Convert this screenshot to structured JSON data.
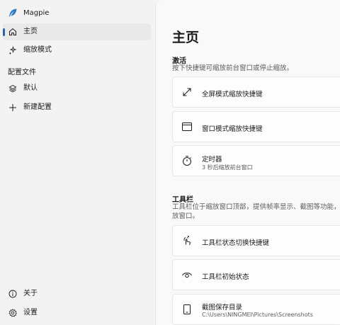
{
  "app": {
    "title": "Magpie"
  },
  "sidebar": {
    "items": [
      {
        "label": "主页",
        "icon": "home-icon",
        "selected": true
      },
      {
        "label": "缩放模式",
        "icon": "sparkle-icon",
        "selected": false
      }
    ],
    "profiles_section": "配置文件",
    "profiles": [
      {
        "label": "默认",
        "icon": "layers-icon"
      },
      {
        "label": "新建配置",
        "icon": "add-icon"
      }
    ],
    "footer": [
      {
        "label": "关于",
        "icon": "info-icon"
      },
      {
        "label": "设置",
        "icon": "gear-icon"
      }
    ]
  },
  "main": {
    "title": "主页",
    "activate": {
      "title": "激活",
      "description": "按下快捷键可缩放前台窗口或停止缩放。",
      "cards": [
        {
          "title": "全屏模式缩放快捷键",
          "icon": "fullscreen-arrows-icon"
        },
        {
          "title": "窗口模式缩放快捷键",
          "icon": "window-icon"
        },
        {
          "title": "定时器",
          "subtitle": "3 秒后缩放前台窗口",
          "icon": "timer-icon"
        }
      ]
    },
    "toolbar": {
      "title": "工具栏",
      "description_line1": "工具栏位于缩放窗口顶部，提供帧率显示、截图等功能，",
      "description_line2": "放窗口。",
      "cards": [
        {
          "title": "工具栏状态切换快捷键",
          "icon": "touch-toggle-icon"
        },
        {
          "title": "工具栏初始状态",
          "icon": "eye-icon"
        },
        {
          "title": "截图保存目录",
          "subtitle": "C:\\Users\\NINGMEI\\Pictures\\Screenshots",
          "icon": "folder-phone-icon"
        }
      ]
    }
  },
  "colors": {
    "accent": "#2b66a8",
    "sidebar_bg": "#f3f3f3",
    "content_bg": "#f9f9f9",
    "card_bg": "#fdfdfd"
  }
}
